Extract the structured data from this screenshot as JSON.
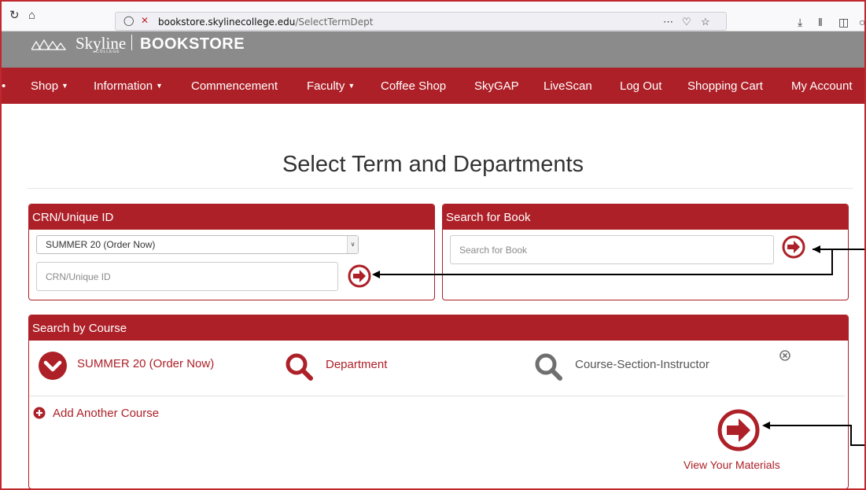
{
  "browser": {
    "url_host": "bookstore.skylinecollege.edu",
    "url_path": "/SelectTermDept"
  },
  "banner": {
    "logo_name": "Skyline",
    "logo_college": "COLLEGE",
    "store_name": "BOOKSTORE"
  },
  "nav": {
    "items": [
      {
        "label": "Shop",
        "dropdown": true
      },
      {
        "label": "Information",
        "dropdown": true
      },
      {
        "label": "Commencement",
        "dropdown": false
      },
      {
        "label": "Faculty",
        "dropdown": true
      },
      {
        "label": "Coffee Shop",
        "dropdown": false
      },
      {
        "label": "SkyGAP",
        "dropdown": false
      },
      {
        "label": "LiveScan",
        "dropdown": false
      },
      {
        "label": "Log Out",
        "dropdown": false
      },
      {
        "label": "Shopping Cart",
        "dropdown": false
      },
      {
        "label": "My Account",
        "dropdown": false
      }
    ]
  },
  "page": {
    "title": "Select Term and Departments"
  },
  "crn_panel": {
    "heading": "CRN/Unique ID",
    "term_selected": "SUMMER 20 (Order Now)",
    "id_placeholder": "CRN/Unique ID"
  },
  "book_panel": {
    "heading": "Search for Book",
    "search_placeholder": "Search for Book"
  },
  "course_panel": {
    "heading": "Search by Course",
    "term_label": "SUMMER 20 (Order Now)",
    "department_label": "Department",
    "course_section_label": "Course-Section-Instructor",
    "add_course_label": "Add Another Course",
    "view_materials_label": "View Your Materials"
  },
  "colors": {
    "brand_red": "#ad2028",
    "banner_gray": "#8b8b8b",
    "inactive_gray": "#6f6f6f"
  }
}
